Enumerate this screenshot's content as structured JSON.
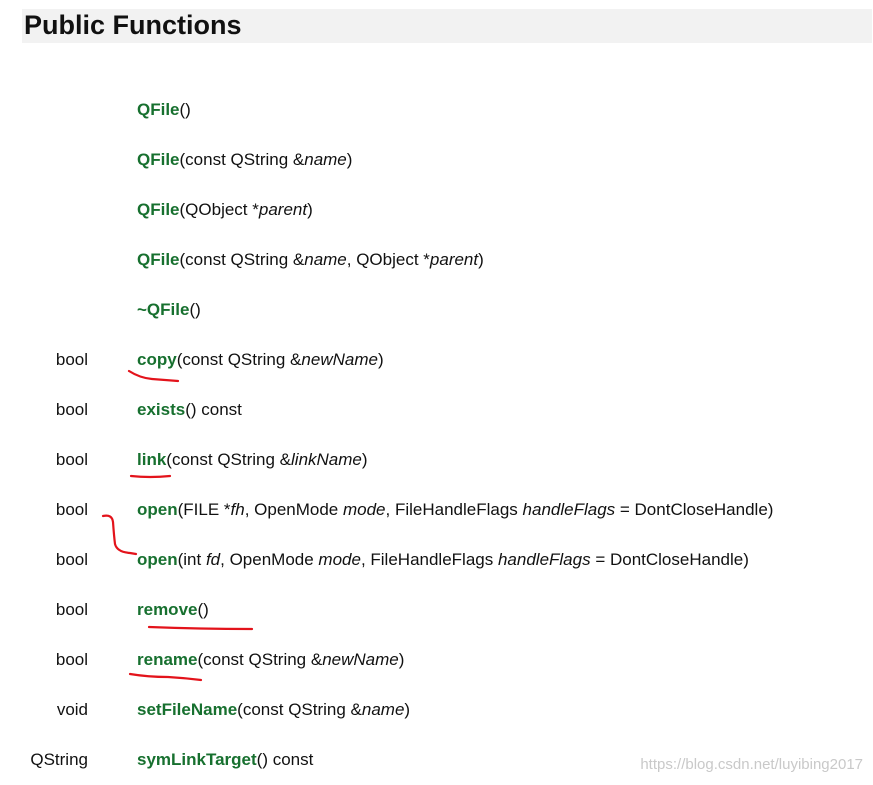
{
  "heading": "Public Functions",
  "rows": [
    {
      "ret": "",
      "parts": [
        {
          "t": "QFile",
          "c": "fn"
        },
        {
          "t": "()",
          "c": ""
        }
      ]
    },
    {
      "ret": "",
      "parts": [
        {
          "t": "QFile",
          "c": "fn"
        },
        {
          "t": "(const QString &",
          "c": ""
        },
        {
          "t": "name",
          "c": "param"
        },
        {
          "t": ")",
          "c": ""
        }
      ]
    },
    {
      "ret": "",
      "parts": [
        {
          "t": "QFile",
          "c": "fn"
        },
        {
          "t": "(QObject *",
          "c": ""
        },
        {
          "t": "parent",
          "c": "param"
        },
        {
          "t": ")",
          "c": ""
        }
      ]
    },
    {
      "ret": "",
      "parts": [
        {
          "t": "QFile",
          "c": "fn"
        },
        {
          "t": "(const QString &",
          "c": ""
        },
        {
          "t": "name",
          "c": "param"
        },
        {
          "t": ", QObject *",
          "c": ""
        },
        {
          "t": "parent",
          "c": "param"
        },
        {
          "t": ")",
          "c": ""
        }
      ]
    },
    {
      "ret": "",
      "parts": [
        {
          "t": "~QFile",
          "c": "fn"
        },
        {
          "t": "()",
          "c": ""
        }
      ]
    },
    {
      "ret": "bool",
      "parts": [
        {
          "t": "copy",
          "c": "fn"
        },
        {
          "t": "(const QString &",
          "c": ""
        },
        {
          "t": "newName",
          "c": "param"
        },
        {
          "t": ")",
          "c": ""
        }
      ]
    },
    {
      "ret": "bool",
      "parts": [
        {
          "t": "exists",
          "c": "fn"
        },
        {
          "t": "() const",
          "c": ""
        }
      ]
    },
    {
      "ret": "bool",
      "parts": [
        {
          "t": "link",
          "c": "fn"
        },
        {
          "t": "(const QString &",
          "c": ""
        },
        {
          "t": "linkName",
          "c": "param"
        },
        {
          "t": ")",
          "c": ""
        }
      ]
    },
    {
      "ret": "bool",
      "parts": [
        {
          "t": "open",
          "c": "fn"
        },
        {
          "t": "(FILE *",
          "c": ""
        },
        {
          "t": "fh",
          "c": "param"
        },
        {
          "t": ", OpenMode ",
          "c": ""
        },
        {
          "t": "mode",
          "c": "param"
        },
        {
          "t": ", FileHandleFlags ",
          "c": ""
        },
        {
          "t": "handleFlags",
          "c": "param"
        },
        {
          "t": " = DontCloseHandle)",
          "c": ""
        }
      ]
    },
    {
      "ret": "bool",
      "parts": [
        {
          "t": "open",
          "c": "fn"
        },
        {
          "t": "(int ",
          "c": ""
        },
        {
          "t": "fd",
          "c": "param"
        },
        {
          "t": ", OpenMode ",
          "c": ""
        },
        {
          "t": "mode",
          "c": "param"
        },
        {
          "t": ", FileHandleFlags ",
          "c": ""
        },
        {
          "t": "handleFlags",
          "c": "param"
        },
        {
          "t": " = DontCloseHandle)",
          "c": ""
        }
      ]
    },
    {
      "ret": "bool",
      "parts": [
        {
          "t": "remove",
          "c": "fn"
        },
        {
          "t": "()",
          "c": ""
        }
      ]
    },
    {
      "ret": "bool",
      "parts": [
        {
          "t": "rename",
          "c": "fn"
        },
        {
          "t": "(const QString &",
          "c": ""
        },
        {
          "t": "newName",
          "c": "param"
        },
        {
          "t": ")",
          "c": ""
        }
      ]
    },
    {
      "ret": "void",
      "parts": [
        {
          "t": "setFileName",
          "c": "fn"
        },
        {
          "t": "(const QString &",
          "c": ""
        },
        {
          "t": "name",
          "c": "param"
        },
        {
          "t": ")",
          "c": ""
        }
      ]
    },
    {
      "ret": "QString",
      "parts": [
        {
          "t": "symLinkTarget",
          "c": "fn"
        },
        {
          "t": "() const",
          "c": ""
        }
      ]
    }
  ],
  "watermark": "https://blog.csdn.net/luyibing2017",
  "colors": {
    "link": "#17702f",
    "annotation": "#e3131b",
    "heading_bg": "#f2f2f2"
  }
}
